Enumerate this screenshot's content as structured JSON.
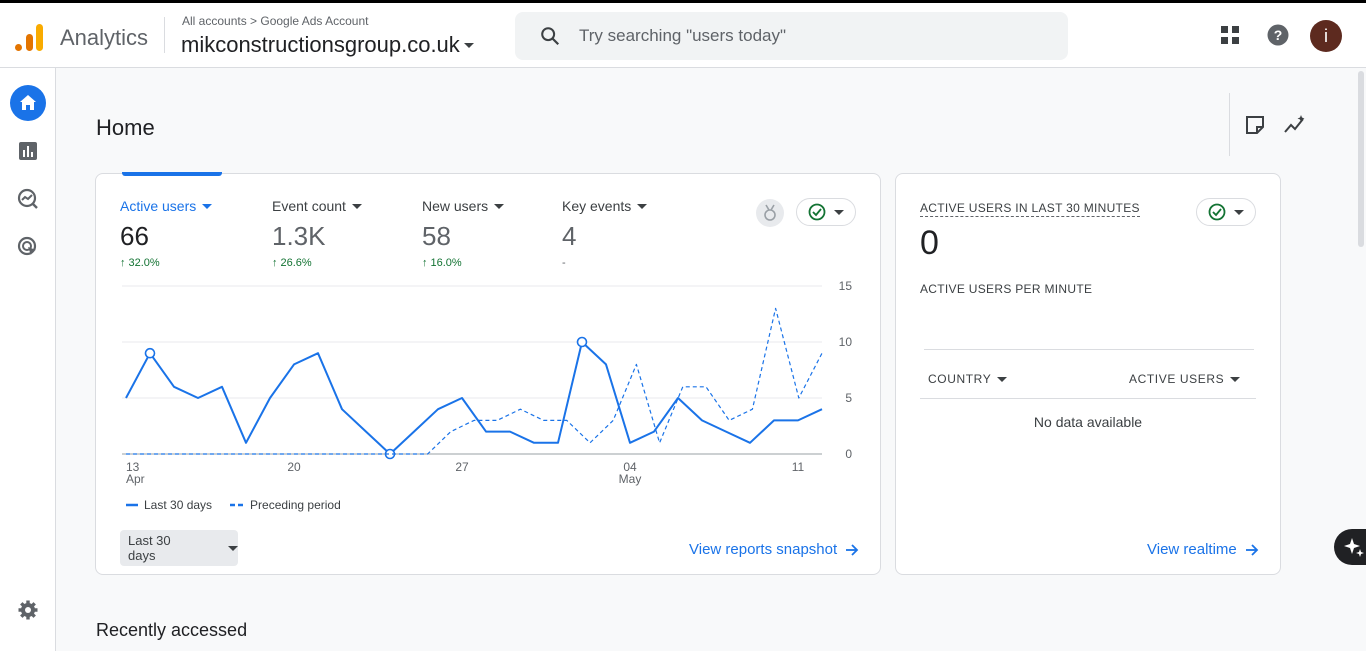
{
  "header": {
    "app_name": "Analytics",
    "breadcrumb": "All accounts > Google Ads Account",
    "account_name": "mikconstructionsgroup.co.uk",
    "search_placeholder": "Try searching \"users today\"",
    "avatar_letter": "i"
  },
  "page": {
    "title": "Home",
    "recently_accessed": "Recently accessed"
  },
  "metrics": [
    {
      "label": "Active users",
      "value": "66",
      "delta": "32.0%"
    },
    {
      "label": "Event count",
      "value": "1.3K",
      "delta": "26.6%"
    },
    {
      "label": "New users",
      "value": "58",
      "delta": "16.0%"
    },
    {
      "label": "Key events",
      "value": "4",
      "delta": "-"
    }
  ],
  "chart_data": {
    "type": "line",
    "x_tick_labels": [
      {
        "day": "13",
        "month": "Apr"
      },
      {
        "day": "20",
        "month": ""
      },
      {
        "day": "27",
        "month": ""
      },
      {
        "day": "04",
        "month": "May"
      },
      {
        "day": "11",
        "month": ""
      }
    ],
    "y_ticks": [
      "15",
      "10",
      "5",
      "0"
    ],
    "ylim": [
      0,
      15
    ],
    "series": [
      {
        "name": "Last 30 days",
        "style": "solid",
        "color": "#1a73e8",
        "values": [
          5,
          9,
          6,
          5,
          6,
          1,
          5,
          8,
          9,
          4,
          2,
          0,
          2,
          4,
          5,
          2,
          2,
          1,
          1,
          10,
          8,
          1,
          2,
          5,
          3,
          2,
          1,
          3,
          3,
          4
        ]
      },
      {
        "name": "Preceding period",
        "style": "dashed",
        "color": "#1a73e8",
        "values": [
          0,
          0,
          0,
          0,
          0,
          0,
          0,
          0,
          0,
          0,
          0,
          0,
          0,
          0,
          2,
          3,
          3,
          4,
          3,
          3,
          1,
          3,
          8,
          1,
          6,
          6,
          3,
          4,
          13,
          5,
          9
        ]
      }
    ],
    "grid": true
  },
  "main_card": {
    "date_range": "Last 30 days",
    "snapshot_link": "View reports snapshot"
  },
  "realtime": {
    "title": "ACTIVE USERS IN LAST 30 MINUTES",
    "value": "0",
    "subtitle": "ACTIVE USERS PER MINUTE",
    "col_country": "COUNTRY",
    "col_active": "ACTIVE USERS",
    "empty": "No data available",
    "link": "View realtime"
  }
}
